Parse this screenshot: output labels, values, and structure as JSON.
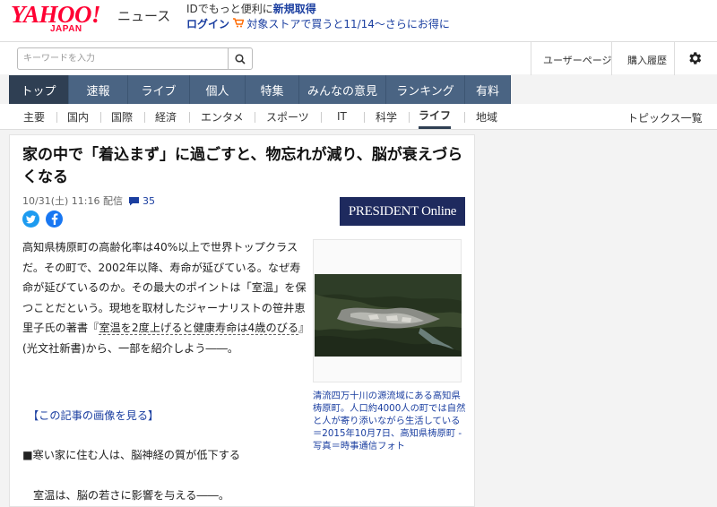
{
  "header": {
    "logo_main": "YAHOO!",
    "logo_sub": "JAPAN",
    "section": "ニュース",
    "promo_line1_prefix": "IDでもっと便利に",
    "promo_line1_link": "新規取得",
    "promo_line2_login": "ログイン",
    "promo_line2_text": "対象ストアで買うと11/14〜さらにお得に"
  },
  "search": {
    "placeholder": "キーワードを入力"
  },
  "toolbar": {
    "user_page": "ユーザーページ",
    "purchase_history": "購入履歴"
  },
  "main_nav": [
    "トップ",
    "速報",
    "ライブ",
    "個人",
    "特集",
    "みんなの意見",
    "ランキング",
    "有料"
  ],
  "category_tabs": [
    "主要",
    "国内",
    "国際",
    "経済",
    "エンタメ",
    "スポーツ",
    "IT",
    "科学",
    "ライフ",
    "地域"
  ],
  "category_active": "ライフ",
  "topics_link": "トピックス一覧",
  "article": {
    "title": "家の中で「着込まず」に過ごすと、物忘れが減り、脳が衰えづらくなる",
    "date": "10/31(土) 11:16 配信",
    "comment_count": "35",
    "publisher": "PRESIDENT Online",
    "body_1": "高知県梼原町の高齢化率は40%以上で世界トップクラスだ。その町で、2002年以降、寿命が延びている。なぜ寿命が延びているのか。その最大のポイントは「室温」を保つことだという。現地を取材したジャーナリストの笹井恵里子氏の著書『",
    "book_title": "室温を2度上げると健康寿命は4歳のびる",
    "body_2": "』(光文社新書)から、一部を紹介しよう――。",
    "image_link": "【この記事の画像を見る】",
    "section_heading": "■寒い家に住む人は、脳神経の質が低下する",
    "para2": "室温は、脳の若さに影響を与える――。",
    "caption": "清流四万十川の源流域にある高知県梼原町。人口約4000人の町では自然と人が寄り添いながら生活している＝2015年10月7日、高知県梼原町 - 写真＝時事通信フォト"
  },
  "colors": {
    "brand_red": "#ff0033",
    "nav_bg": "#4a6483",
    "nav_active": "#2f3f53",
    "link_blue": "#1a3ea0",
    "publisher_bg": "#1e2a5e"
  },
  "icons": [
    "search-icon",
    "gear-icon",
    "comment-icon",
    "cart-icon",
    "twitter-icon",
    "facebook-icon"
  ]
}
